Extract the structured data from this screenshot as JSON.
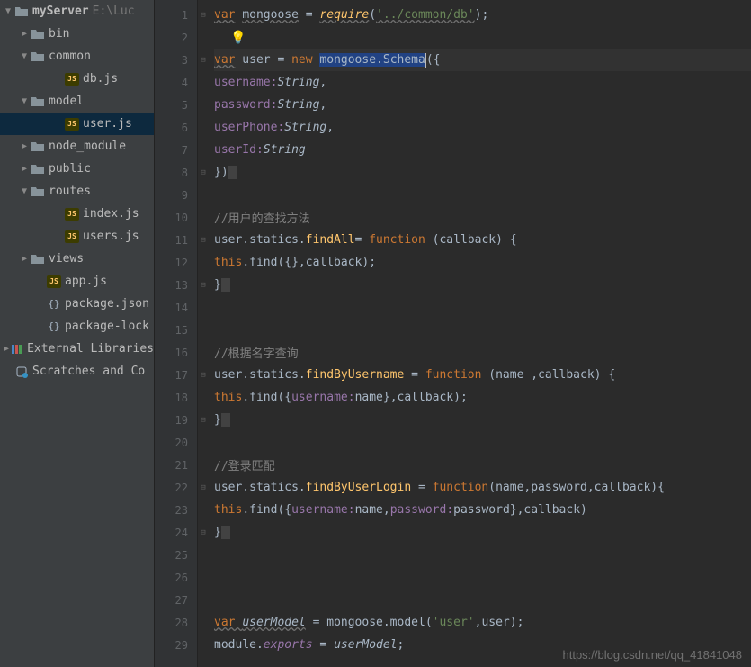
{
  "sidebar": {
    "root": {
      "label": "myServer",
      "path": "E:\\Luc"
    },
    "items": [
      {
        "label": "bin",
        "type": "folder",
        "arrow": "▶",
        "indent": 1
      },
      {
        "label": "common",
        "type": "folder",
        "arrow": "▼",
        "indent": 1
      },
      {
        "label": "db.js",
        "type": "js",
        "arrow": "",
        "indent": 3
      },
      {
        "label": "model",
        "type": "folder",
        "arrow": "▼",
        "indent": 1
      },
      {
        "label": "user.js",
        "type": "js",
        "arrow": "",
        "indent": 3,
        "selected": true
      },
      {
        "label": "node_module",
        "type": "folder",
        "arrow": "▶",
        "indent": 1
      },
      {
        "label": "public",
        "type": "folder",
        "arrow": "▶",
        "indent": 1
      },
      {
        "label": "routes",
        "type": "folder",
        "arrow": "▼",
        "indent": 1
      },
      {
        "label": "index.js",
        "type": "js",
        "arrow": "",
        "indent": 3
      },
      {
        "label": "users.js",
        "type": "js",
        "arrow": "",
        "indent": 3
      },
      {
        "label": "views",
        "type": "folder",
        "arrow": "▶",
        "indent": 1
      },
      {
        "label": "app.js",
        "type": "js",
        "arrow": "",
        "indent": 2
      },
      {
        "label": "package.json",
        "type": "json",
        "arrow": "",
        "indent": 2
      },
      {
        "label": "package-lock",
        "type": "json",
        "arrow": "",
        "indent": 2
      }
    ],
    "external": "External Libraries",
    "scratches": "Scratches and Co"
  },
  "code": {
    "lines": [
      1,
      2,
      3,
      4,
      5,
      6,
      7,
      8,
      9,
      10,
      11,
      12,
      13,
      14,
      15,
      16,
      17,
      18,
      19,
      20,
      21,
      22,
      23,
      24,
      25,
      26,
      27,
      28,
      29
    ],
    "l1_var": "var",
    "l1_mongoose": "mongoose",
    "l1_eq": " = ",
    "l1_require": "require",
    "l1_p1": "(",
    "l1_str": "'../common/db'",
    "l1_p2": ");",
    "l3_var": "var",
    "l3_user": " user = ",
    "l3_new": "new ",
    "l3_sel": "mongoose.Schem",
    "l3_a": "a",
    "l3_rest": "({",
    "l4_k": "username:",
    "l4_t": "String",
    "l4_c": ",",
    "l5_k": "password:",
    "l5_t": "String",
    "l5_c": ",",
    "l6_k": "userPhone:",
    "l6_t": "String",
    "l6_c": ",",
    "l7_k": "userId:",
    "l7_t": "String",
    "l8": "})",
    "l10": "//用户的查找方法",
    "l11_a": "user.statics.",
    "l11_b": "findAll",
    "l11_c": "= ",
    "l11_d": "function ",
    "l11_e": "(callback) {",
    "l12_a": "this",
    "l12_b": ".find({},callback);",
    "l13": "}",
    "l16": "//根据名字查询",
    "l17_a": "user.statics.",
    "l17_b": "findByUsername",
    "l17_c": " = ",
    "l17_d": "function ",
    "l17_e": "(name ,callback) {",
    "l18_a": "this",
    "l18_b": ".find({",
    "l18_c": "username:",
    "l18_d": "name},callback);",
    "l19": "}",
    "l21": "//登录匹配",
    "l22_a": "user.statics.",
    "l22_b": "findByUserLogin",
    "l22_c": " = ",
    "l22_d": "function",
    "l22_e": "(name,password,callback){",
    "l23_a": "this",
    "l23_b": ".find({",
    "l23_c": "username:",
    "l23_d": "name,",
    "l23_e": "password:",
    "l23_f": "password},callback)",
    "l24": "}",
    "l28_a": "var ",
    "l28_b": "userModel",
    "l28_c": " = mongoose.model(",
    "l28_d": "'user'",
    "l28_e": ",user);",
    "l29_a": "module.",
    "l29_b": "exports",
    "l29_c": " = ",
    "l29_d": "userModel",
    "l29_e": ";"
  },
  "watermark": "https://blog.csdn.net/qq_41841048"
}
